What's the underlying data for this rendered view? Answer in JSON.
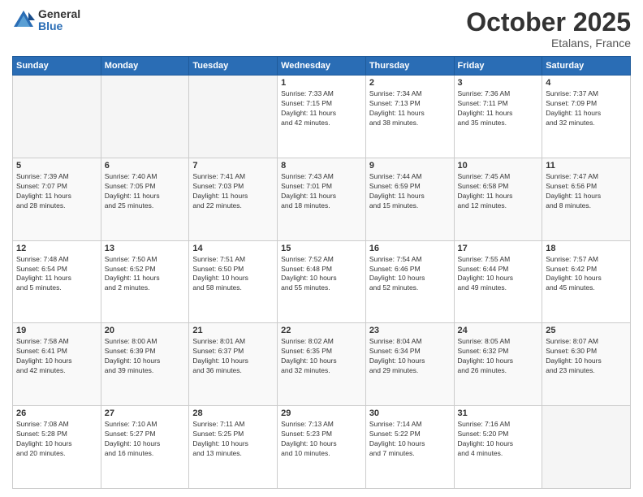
{
  "logo": {
    "general": "General",
    "blue": "Blue"
  },
  "title": "October 2025",
  "subtitle": "Etalans, France",
  "days_of_week": [
    "Sunday",
    "Monday",
    "Tuesday",
    "Wednesday",
    "Thursday",
    "Friday",
    "Saturday"
  ],
  "weeks": [
    [
      {
        "day": "",
        "info": ""
      },
      {
        "day": "",
        "info": ""
      },
      {
        "day": "",
        "info": ""
      },
      {
        "day": "1",
        "info": "Sunrise: 7:33 AM\nSunset: 7:15 PM\nDaylight: 11 hours\nand 42 minutes."
      },
      {
        "day": "2",
        "info": "Sunrise: 7:34 AM\nSunset: 7:13 PM\nDaylight: 11 hours\nand 38 minutes."
      },
      {
        "day": "3",
        "info": "Sunrise: 7:36 AM\nSunset: 7:11 PM\nDaylight: 11 hours\nand 35 minutes."
      },
      {
        "day": "4",
        "info": "Sunrise: 7:37 AM\nSunset: 7:09 PM\nDaylight: 11 hours\nand 32 minutes."
      }
    ],
    [
      {
        "day": "5",
        "info": "Sunrise: 7:39 AM\nSunset: 7:07 PM\nDaylight: 11 hours\nand 28 minutes."
      },
      {
        "day": "6",
        "info": "Sunrise: 7:40 AM\nSunset: 7:05 PM\nDaylight: 11 hours\nand 25 minutes."
      },
      {
        "day": "7",
        "info": "Sunrise: 7:41 AM\nSunset: 7:03 PM\nDaylight: 11 hours\nand 22 minutes."
      },
      {
        "day": "8",
        "info": "Sunrise: 7:43 AM\nSunset: 7:01 PM\nDaylight: 11 hours\nand 18 minutes."
      },
      {
        "day": "9",
        "info": "Sunrise: 7:44 AM\nSunset: 6:59 PM\nDaylight: 11 hours\nand 15 minutes."
      },
      {
        "day": "10",
        "info": "Sunrise: 7:45 AM\nSunset: 6:58 PM\nDaylight: 11 hours\nand 12 minutes."
      },
      {
        "day": "11",
        "info": "Sunrise: 7:47 AM\nSunset: 6:56 PM\nDaylight: 11 hours\nand 8 minutes."
      }
    ],
    [
      {
        "day": "12",
        "info": "Sunrise: 7:48 AM\nSunset: 6:54 PM\nDaylight: 11 hours\nand 5 minutes."
      },
      {
        "day": "13",
        "info": "Sunrise: 7:50 AM\nSunset: 6:52 PM\nDaylight: 11 hours\nand 2 minutes."
      },
      {
        "day": "14",
        "info": "Sunrise: 7:51 AM\nSunset: 6:50 PM\nDaylight: 10 hours\nand 58 minutes."
      },
      {
        "day": "15",
        "info": "Sunrise: 7:52 AM\nSunset: 6:48 PM\nDaylight: 10 hours\nand 55 minutes."
      },
      {
        "day": "16",
        "info": "Sunrise: 7:54 AM\nSunset: 6:46 PM\nDaylight: 10 hours\nand 52 minutes."
      },
      {
        "day": "17",
        "info": "Sunrise: 7:55 AM\nSunset: 6:44 PM\nDaylight: 10 hours\nand 49 minutes."
      },
      {
        "day": "18",
        "info": "Sunrise: 7:57 AM\nSunset: 6:42 PM\nDaylight: 10 hours\nand 45 minutes."
      }
    ],
    [
      {
        "day": "19",
        "info": "Sunrise: 7:58 AM\nSunset: 6:41 PM\nDaylight: 10 hours\nand 42 minutes."
      },
      {
        "day": "20",
        "info": "Sunrise: 8:00 AM\nSunset: 6:39 PM\nDaylight: 10 hours\nand 39 minutes."
      },
      {
        "day": "21",
        "info": "Sunrise: 8:01 AM\nSunset: 6:37 PM\nDaylight: 10 hours\nand 36 minutes."
      },
      {
        "day": "22",
        "info": "Sunrise: 8:02 AM\nSunset: 6:35 PM\nDaylight: 10 hours\nand 32 minutes."
      },
      {
        "day": "23",
        "info": "Sunrise: 8:04 AM\nSunset: 6:34 PM\nDaylight: 10 hours\nand 29 minutes."
      },
      {
        "day": "24",
        "info": "Sunrise: 8:05 AM\nSunset: 6:32 PM\nDaylight: 10 hours\nand 26 minutes."
      },
      {
        "day": "25",
        "info": "Sunrise: 8:07 AM\nSunset: 6:30 PM\nDaylight: 10 hours\nand 23 minutes."
      }
    ],
    [
      {
        "day": "26",
        "info": "Sunrise: 7:08 AM\nSunset: 5:28 PM\nDaylight: 10 hours\nand 20 minutes."
      },
      {
        "day": "27",
        "info": "Sunrise: 7:10 AM\nSunset: 5:27 PM\nDaylight: 10 hours\nand 16 minutes."
      },
      {
        "day": "28",
        "info": "Sunrise: 7:11 AM\nSunset: 5:25 PM\nDaylight: 10 hours\nand 13 minutes."
      },
      {
        "day": "29",
        "info": "Sunrise: 7:13 AM\nSunset: 5:23 PM\nDaylight: 10 hours\nand 10 minutes."
      },
      {
        "day": "30",
        "info": "Sunrise: 7:14 AM\nSunset: 5:22 PM\nDaylight: 10 hours\nand 7 minutes."
      },
      {
        "day": "31",
        "info": "Sunrise: 7:16 AM\nSunset: 5:20 PM\nDaylight: 10 hours\nand 4 minutes."
      },
      {
        "day": "",
        "info": ""
      }
    ]
  ]
}
